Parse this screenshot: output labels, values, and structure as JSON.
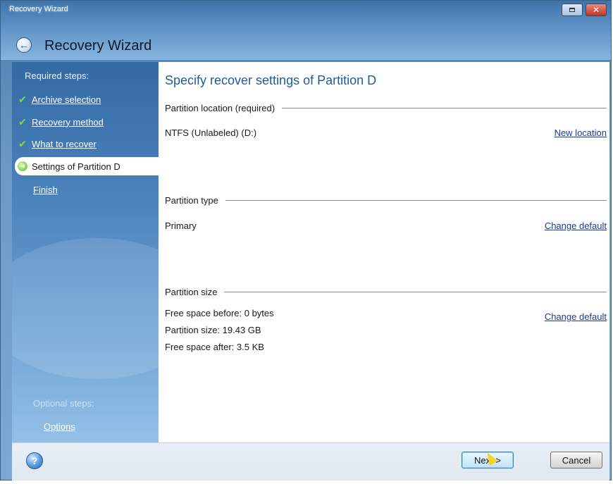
{
  "window": {
    "caption": "Recovery Wizard",
    "app_title": "Recovery Wizard",
    "close_glyph": "✕"
  },
  "sidebar": {
    "required_heading": "Required steps:",
    "items": [
      {
        "label": "Archive selection",
        "state": "done"
      },
      {
        "label": "Recovery method",
        "state": "done"
      },
      {
        "label": "What to recover",
        "state": "done"
      },
      {
        "label": "Settings of Partition D",
        "state": "current"
      },
      {
        "label": "Finish",
        "state": "pending"
      }
    ],
    "optional_heading": "Optional steps:",
    "optional_items": [
      {
        "label": "Options"
      }
    ]
  },
  "content": {
    "title": "Specify recover settings of Partition D",
    "location": {
      "heading": "Partition location (required)",
      "value": "NTFS (Unlabeled) (D:)",
      "link": "New location"
    },
    "type": {
      "heading": "Partition type",
      "value": "Primary",
      "link": "Change default"
    },
    "size": {
      "heading": "Partition size",
      "free_before": "Free space before: 0 bytes",
      "partition_size": "Partition size: 19.43 GB",
      "free_after": "Free space after: 3.5 KB",
      "link": "Change default"
    }
  },
  "footer": {
    "help_glyph": "?",
    "next_label": "Next >",
    "cancel_label": "Cancel"
  },
  "icons": {
    "check": "check-icon",
    "current_step": "arrow-right-icon",
    "back": "back-arrow-icon",
    "help": "help-icon"
  },
  "colors": {
    "sidebar_top": "#346aa3",
    "title_blue": "#1f5a9e",
    "link_blue": "#1a3d8f",
    "check_green": "#7ddc3c"
  }
}
